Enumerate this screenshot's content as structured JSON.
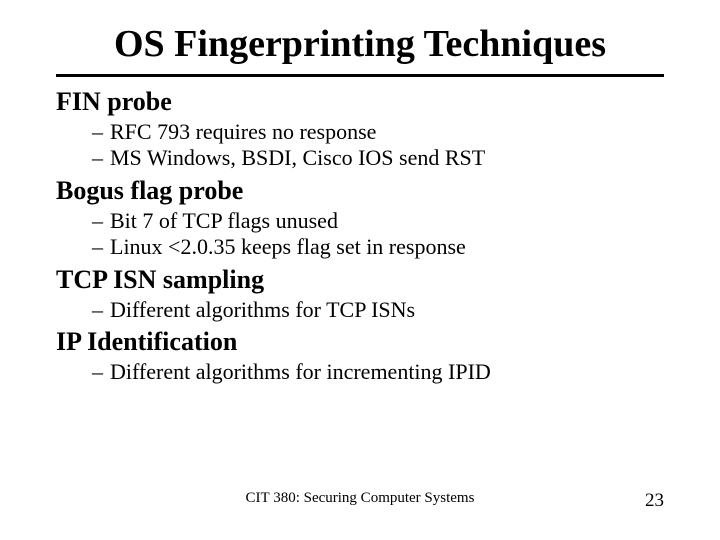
{
  "title": "OS Fingerprinting Techniques",
  "sections": [
    {
      "heading": "FIN probe",
      "bullets": [
        "RFC 793 requires no response",
        "MS Windows, BSDI, Cisco IOS send RST"
      ]
    },
    {
      "heading": "Bogus flag probe",
      "bullets": [
        "Bit 7 of TCP flags unused",
        "Linux <2.0.35 keeps flag set in response"
      ]
    },
    {
      "heading": "TCP ISN sampling",
      "bullets": [
        "Different algorithms for TCP ISNs"
      ]
    },
    {
      "heading": "IP Identification",
      "bullets": [
        "Different algorithms for incrementing IPID"
      ]
    }
  ],
  "footer": {
    "center": "CIT 380: Securing Computer Systems",
    "page": "23"
  }
}
